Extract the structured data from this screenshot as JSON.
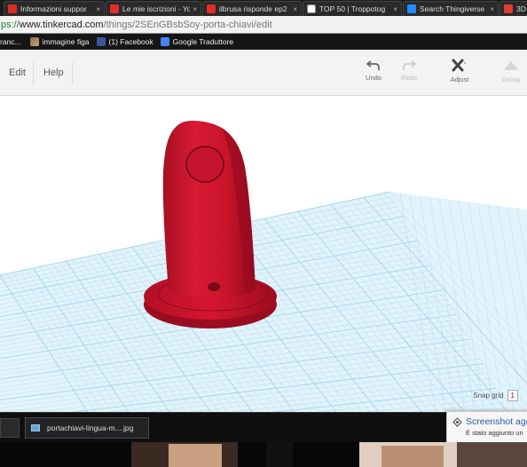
{
  "browser": {
    "tabs": [
      {
        "label": "Informazioni suppor",
        "favicon_color": "#d93025"
      },
      {
        "label": "Le mie iscrizioni - Yo",
        "favicon_color": "#e52d27"
      },
      {
        "label": "ilbrusa risponde ep2",
        "favicon_color": "#e52d27"
      },
      {
        "label": "TOP 50 | Troppotog",
        "favicon_color": "#222222"
      },
      {
        "label": "Search Thingiverse",
        "favicon_color": "#248bfb"
      },
      {
        "label": "3D",
        "favicon_color": "#e13d2f"
      }
    ],
    "tab_close_glyph": "×",
    "address": {
      "scheme": "ps://",
      "host": "www.tinkercad.com",
      "path": "/things/2SEnGBsbSoy-porta-chiavi/edit"
    },
    "bookmarks": [
      {
        "label": "ranc...",
        "icon": "folder-icon"
      },
      {
        "label": "immagine figa",
        "icon": "image-bookmark-icon"
      },
      {
        "label": "(1) Facebook",
        "icon": "facebook-icon"
      },
      {
        "label": "Google Traduttore",
        "icon": "translate-icon"
      }
    ]
  },
  "app": {
    "menu": {
      "edit": "Edit",
      "help": "Help"
    },
    "tools": {
      "undo": "Undo",
      "redo": "Redo",
      "adjust": "Adjust",
      "group": "Group"
    },
    "snap_grid": {
      "label": "Snap grid",
      "value": "1"
    },
    "colors": {
      "model": "#d41830",
      "grid_line": "#9fd4ea",
      "workplane": "#dff2fb"
    }
  },
  "taskbar": {
    "item_label": "portachiavi-lingua-m....jpg"
  },
  "notification": {
    "title": "Screenshot agg",
    "message": "È stato aggiunto un"
  }
}
